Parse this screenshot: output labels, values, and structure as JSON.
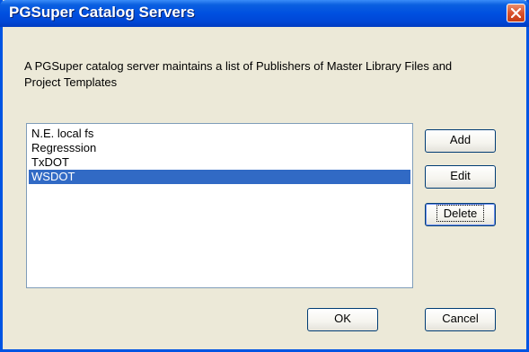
{
  "window": {
    "title": "PGSuper Catalog Servers"
  },
  "description": "A PGSuper catalog server maintains a list of Publishers of Master Library Files and Project Templates",
  "servers": [
    {
      "label": "N.E. local fs",
      "selected": false
    },
    {
      "label": "Regresssion",
      "selected": false
    },
    {
      "label": "TxDOT",
      "selected": false
    },
    {
      "label": "WSDOT",
      "selected": true
    }
  ],
  "buttons": {
    "add": "Add",
    "edit": "Edit",
    "delete": "Delete",
    "ok": "OK",
    "cancel": "Cancel"
  },
  "colors": {
    "selection": "#316ac5",
    "titlebar": "#0050e0",
    "dialog_bg": "#ece9d8"
  },
  "icons": {
    "close": "close-icon"
  }
}
